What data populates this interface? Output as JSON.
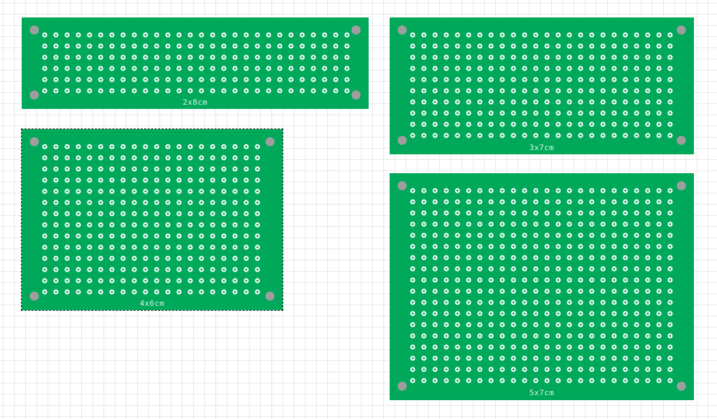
{
  "canvas": {
    "background_color": "#ffffff",
    "grid_color": "#e8e8e8"
  },
  "style": {
    "board_color": "#00a85a",
    "mount_hole_color": "#9e9e9e",
    "pad_ring_color": "#ffffff",
    "pad_center_color": "#00a85a",
    "label_color": "#d9f5e6",
    "selection_outline_color": "#1a1a1a"
  },
  "boards": [
    {
      "id": "2x8",
      "label": "2x8cm",
      "rows": 6,
      "cols": 28,
      "selected": false
    },
    {
      "id": "3x7",
      "label": "3x7cm",
      "rows": 10,
      "cols": 24,
      "selected": false
    },
    {
      "id": "4x6",
      "label": "4x6cm",
      "rows": 14,
      "cols": 20,
      "selected": true
    },
    {
      "id": "5x7",
      "label": "5x7cm",
      "rows": 18,
      "cols": 24,
      "selected": false
    }
  ]
}
